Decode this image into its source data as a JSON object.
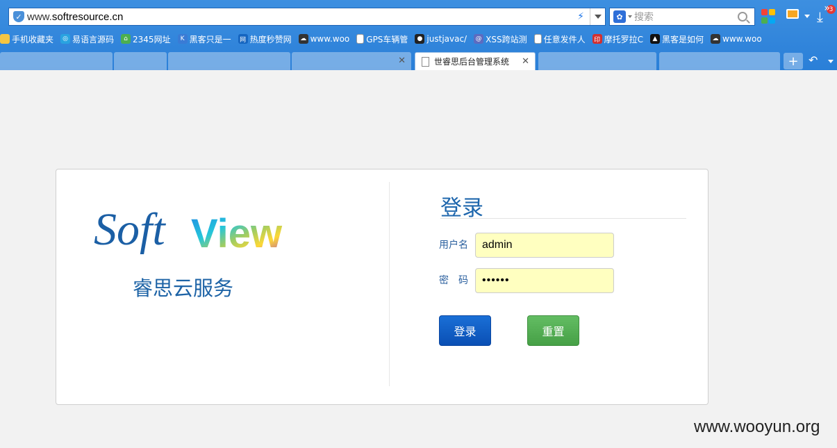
{
  "browser": {
    "url_prefix": "www.",
    "url_host": "softresource.cn",
    "search_placeholder": "搜索",
    "download_badge": "3",
    "bookmarks": [
      {
        "label": "手机收藏夹",
        "icon": "folder-icon",
        "color": "#f5c542"
      },
      {
        "label": "易语言源码",
        "icon": "globe-icon",
        "color": "#29a3e0"
      },
      {
        "label": "2345网址",
        "icon": "house-icon",
        "color": "#4caf50"
      },
      {
        "label": "黑客只是一",
        "icon": "k-icon",
        "color": "#3a7bd5"
      },
      {
        "label": "热度秒赞网",
        "icon": "qzone-icon",
        "color": "#1565c0"
      },
      {
        "label": "www.woo",
        "icon": "wooyun-icon",
        "color": "#333333"
      },
      {
        "label": "GPS车辆管",
        "icon": "page-icon",
        "color": "#ffffff"
      },
      {
        "label": "justjavac/",
        "icon": "github-icon",
        "color": "#222222"
      },
      {
        "label": "XSS跨站测",
        "icon": "xss-icon",
        "color": "#5c6bc0"
      },
      {
        "label": "任意发件人",
        "icon": "page-icon",
        "color": "#ffffff"
      },
      {
        "label": "摩托罗拉C",
        "icon": "stamp-icon",
        "color": "#d32f2f"
      },
      {
        "label": "黑客是如何",
        "icon": "hat-icon",
        "color": "#111111"
      },
      {
        "label": "www.woo",
        "icon": "wooyun-icon",
        "color": "#333333"
      }
    ],
    "active_tab_label": "世睿思后台管理系统"
  },
  "login": {
    "logo_text_soft": "Soft",
    "logo_text_view": "View",
    "subtitle": "睿思云服务",
    "title": "登录",
    "username_label": "用户名",
    "username_value": "admin",
    "password_label": "密　码",
    "password_value": "••••••",
    "login_button": "登录",
    "reset_button": "重置"
  },
  "watermark": "www.wooyun.org",
  "colors": {
    "accent": "#1f67ad",
    "login_button": "#0a5ac6",
    "reset_button": "#52ad52",
    "input_bg": "#ffffc0"
  }
}
